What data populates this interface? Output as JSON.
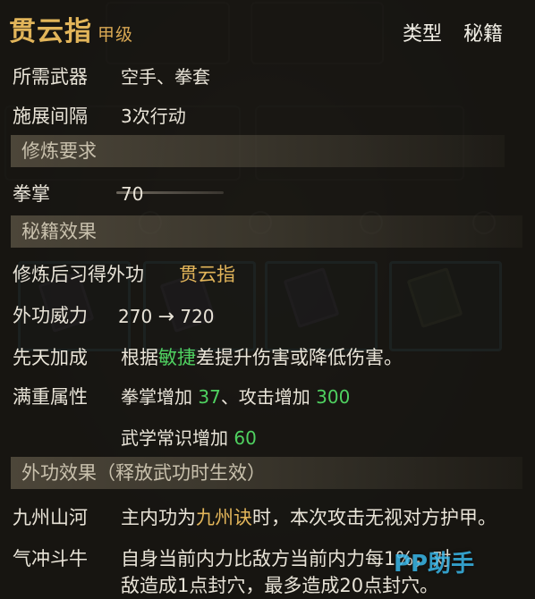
{
  "header": {
    "title": "贯云指",
    "grade": "甲级",
    "type_label": "类型",
    "type_value": "秘籍"
  },
  "requirements": {
    "weapon_label": "所需武器",
    "weapon_value": "空手、拳套",
    "interval_label": "施展间隔",
    "interval_value": "3次行动"
  },
  "section_train_req": "修炼要求",
  "train_req": {
    "skill_label": "拳掌",
    "skill_value": "70"
  },
  "section_effects": "秘籍效果",
  "effects": {
    "learn_label": "修炼后习得外功",
    "learn_value": "贯云指",
    "power_label": "外功威力",
    "power_from": "270",
    "power_arrow": "→",
    "power_to": "720",
    "innate_label": "先天加成",
    "innate_pre": "根据",
    "innate_attr": "敏捷",
    "innate_post": "差提升伤害或降低伤害。",
    "full_label": "满重属性",
    "full_line1_a": "拳掌增加",
    "full_line1_a_val": "37",
    "full_line1_b": "、攻击增加",
    "full_line1_b_val": "300",
    "full_line2": "武学常识增加",
    "full_line2_val": "60"
  },
  "section_outer": "外功效果（释放武功时生效）",
  "outer": {
    "e1_label": "九州山河",
    "e1_pre": "主内功为",
    "e1_name": "九州诀",
    "e1_post": "时，本次攻击无视对方护甲。",
    "e2_label": "气冲斗牛",
    "e2_line1": "自身当前内力比敌方当前内力每1%，对",
    "e2_line2": "敌造成1点封穴，最多造成20点封穴。"
  },
  "watermark": "PP助手",
  "colors": {
    "title": "#e2b55a",
    "highlight_green": "#4fd160",
    "section_bg": "#6f6552"
  }
}
